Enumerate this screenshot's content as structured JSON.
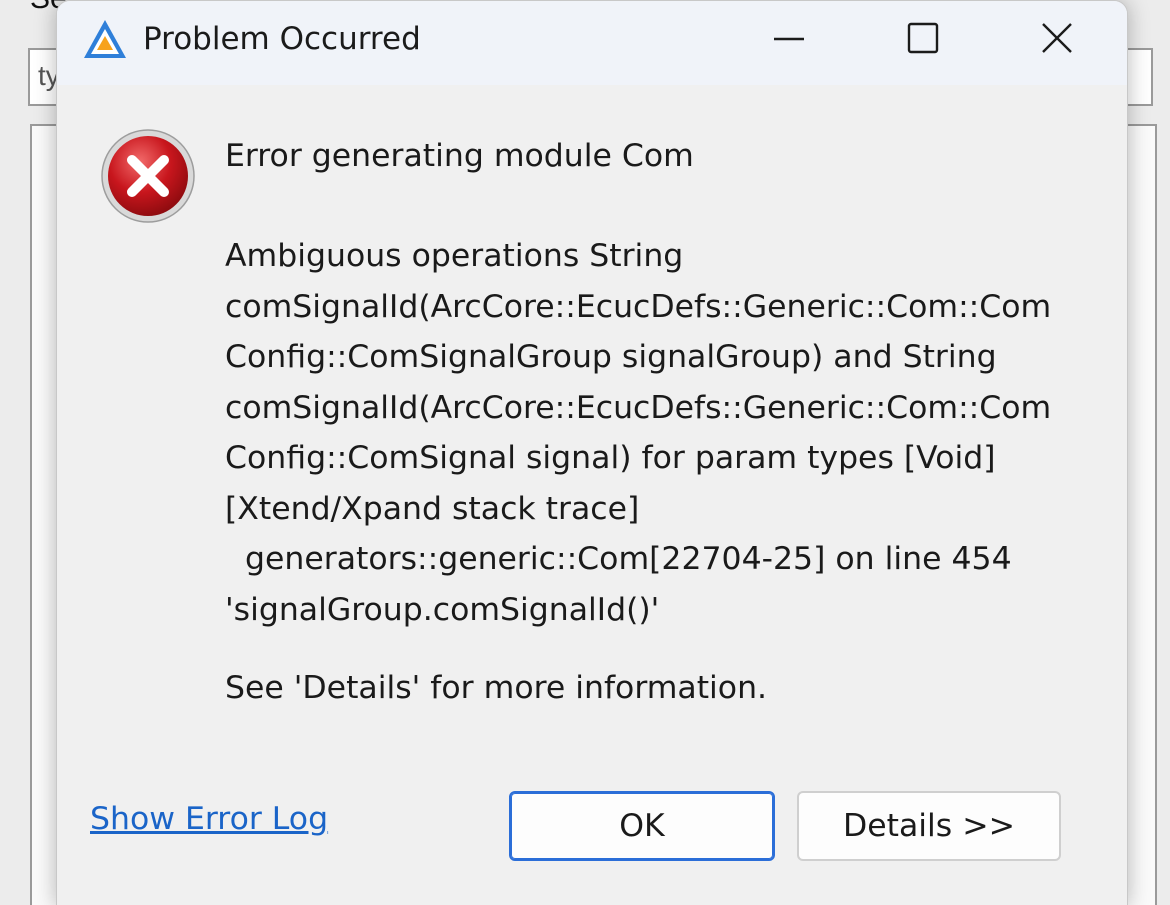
{
  "background": {
    "label_fragment": "Se",
    "input_fragment": "ty"
  },
  "dialog": {
    "title": "Problem Occurred",
    "icons": {
      "app": "eclipse-arccore-triangle-icon",
      "error": "error-x-circle-icon",
      "minimize": "minimize-icon",
      "maximize": "maximize-icon",
      "close": "close-icon"
    },
    "message_title": "Error generating module Com",
    "message_lines": [
      "Ambiguous operations String",
      "comSignalId(ArcCore::EcucDefs::Generic::Com::Com",
      "Config::ComSignalGroup signalGroup) and String",
      "comSignalId(ArcCore::EcucDefs::Generic::Com::Com",
      "Config::ComSignal signal) for param types [Void]",
      "[Xtend/Xpand stack trace]",
      "  generators::generic::Com[22704-25] on line 454",
      "'signalGroup.comSignalId()'"
    ],
    "message_footer": "See 'Details' for more information.",
    "link_label": "Show Error Log",
    "ok_label": "OK",
    "details_label": "Details >>"
  },
  "colors": {
    "link": "#1a64c8",
    "ok_border": "#2b6ed8",
    "error_red": "#c8161d"
  }
}
